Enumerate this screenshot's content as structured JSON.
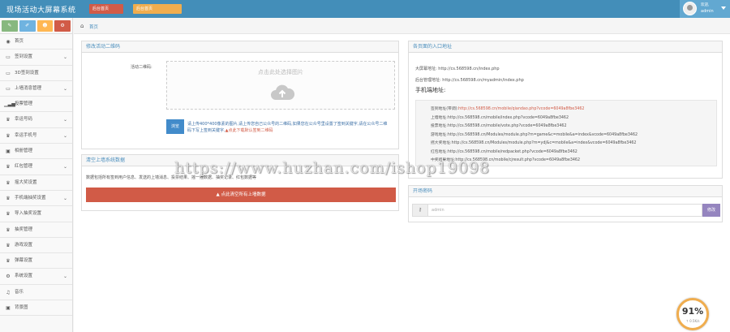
{
  "app": {
    "title": "现场活动大屏幕系统",
    "top_buttons": [
      "后台首页",
      "后台首页"
    ]
  },
  "user": {
    "welcome": "欢迎,",
    "name": "admin"
  },
  "sidebar": {
    "shortcut_icons": [
      "signal-icon",
      "pencil-icon",
      "users-icon",
      "cogs-icon"
    ],
    "items": [
      {
        "label": "首页",
        "icon": "dashboard-icon",
        "icon_glyph": "◉",
        "has_children": false
      },
      {
        "label": "签到设置",
        "icon": "desktop-icon",
        "icon_glyph": "▭",
        "has_children": true
      },
      {
        "label": "3D签到设置",
        "icon": "monitor-icon",
        "icon_glyph": "▭",
        "has_children": false
      },
      {
        "label": "上墙消息管理",
        "icon": "desktop-icon",
        "icon_glyph": "▭",
        "has_children": true
      },
      {
        "label": "投票管理",
        "icon": "bar-chart-icon",
        "icon_glyph": "▁▃▅",
        "has_children": false
      },
      {
        "label": "幸运号码",
        "icon": "trophy-icon",
        "icon_glyph": "♛",
        "has_children": true
      },
      {
        "label": "幸运手机号",
        "icon": "trophy-icon",
        "icon_glyph": "♛",
        "has_children": true
      },
      {
        "label": "相册管理",
        "icon": "picture-icon",
        "icon_glyph": "▣",
        "has_children": false
      },
      {
        "label": "红包管理",
        "icon": "trophy-icon",
        "icon_glyph": "♛",
        "has_children": true
      },
      {
        "label": "摇大奖设置",
        "icon": "trophy-icon",
        "icon_glyph": "♛",
        "has_children": false
      },
      {
        "label": "手机端抽奖设置",
        "icon": "trophy-icon",
        "icon_glyph": "♛",
        "has_children": true
      },
      {
        "label": "导入抽奖设置",
        "icon": "trophy-icon",
        "icon_glyph": "♛",
        "has_children": false
      },
      {
        "label": "抽奖管理",
        "icon": "trophy-icon",
        "icon_glyph": "♛",
        "has_children": false
      },
      {
        "label": "游戏设置",
        "icon": "trophy-icon",
        "icon_glyph": "♛",
        "has_children": false
      },
      {
        "label": "弹幕设置",
        "icon": "trophy-icon",
        "icon_glyph": "♛",
        "has_children": false
      },
      {
        "label": "系统设置",
        "icon": "gear-icon",
        "icon_glyph": "⚙",
        "has_children": true
      },
      {
        "label": "音乐",
        "icon": "music-icon",
        "icon_glyph": "♫",
        "has_children": false
      },
      {
        "label": "背景图",
        "icon": "picture-icon",
        "icon_glyph": "▣",
        "has_children": false
      }
    ]
  },
  "breadcrumb": {
    "home": "首页"
  },
  "qr_panel": {
    "title": "修改活动二维码",
    "label": "活动二维码:",
    "upload_text": "点击此处选择图片",
    "select_button": "浏览",
    "hint": "请上传400*400像素的图片,请上传您自己公众号的二维码,如果您在公众号里设置了签到关键字,请在公众号二维码下写上签到关键字,",
    "hint_warn": "▲点此下载默认签到二维码"
  },
  "clear_panel": {
    "title": "清空上墙系统数据",
    "desc": "数据包括所有签到用户信息、发送的上墙消息、投票结果、摇一摇数据、抽奖记录、红包数据等",
    "button": "▲ 点此清空所有上墙数据"
  },
  "address_panel": {
    "title": "各页面的入口地址",
    "screen_label": "大屏幕地址:",
    "screen_url": "http://cs.568598.cn/index.php",
    "admin_label": "后台管理地址:",
    "admin_url": "http://cs.568598.cn/myadmin/index.php",
    "mobile_title": "手机端地址:",
    "mobile_rows": [
      {
        "label": "签到地址(带调):",
        "url": "http://cs.568598.cn/mobile/qiandao.php?vcode=6049a8fbe3462",
        "highlight": true
      },
      {
        "label": "上墙地址:",
        "url": "http://cs.568598.cn/mobile/index.php?vcode=6049a8fbe3462",
        "highlight": false
      },
      {
        "label": "投票地址:",
        "url": "http://cs.568598.cn/mobile/vote.php?vcode=6049a8fbe3462",
        "highlight": false
      },
      {
        "label": "游戏地址:",
        "url": "http://cs.568598.cn/Modules/module.php?m=game&c=mobile&a=index&vcode=6049a8fbe3462",
        "highlight": false
      },
      {
        "label": "摇大奖地址:",
        "url": "http://cs.568598.cn/Modules/module.php?m=ydj&c=mobile&a=index&vcode=6049a8fbe3462",
        "highlight": false
      },
      {
        "label": "红包地址:",
        "url": "http://cs.568598.cn/mobile/redpacket.php?vcode=6049a8fbe3462",
        "highlight": false
      },
      {
        "label": "中奖结果地址:",
        "url": "http://cs.568598.cn/mobile/cjresult.php?vcode=6049a8fbe3462",
        "highlight": false
      }
    ]
  },
  "password_panel": {
    "title": "开场密码",
    "value": "admin",
    "button": "修改"
  },
  "watermark": "https://www.huzhan.com/ishop19098",
  "speed_widget": {
    "percent": "91%",
    "rate": "↑ 0.5K/s"
  }
}
